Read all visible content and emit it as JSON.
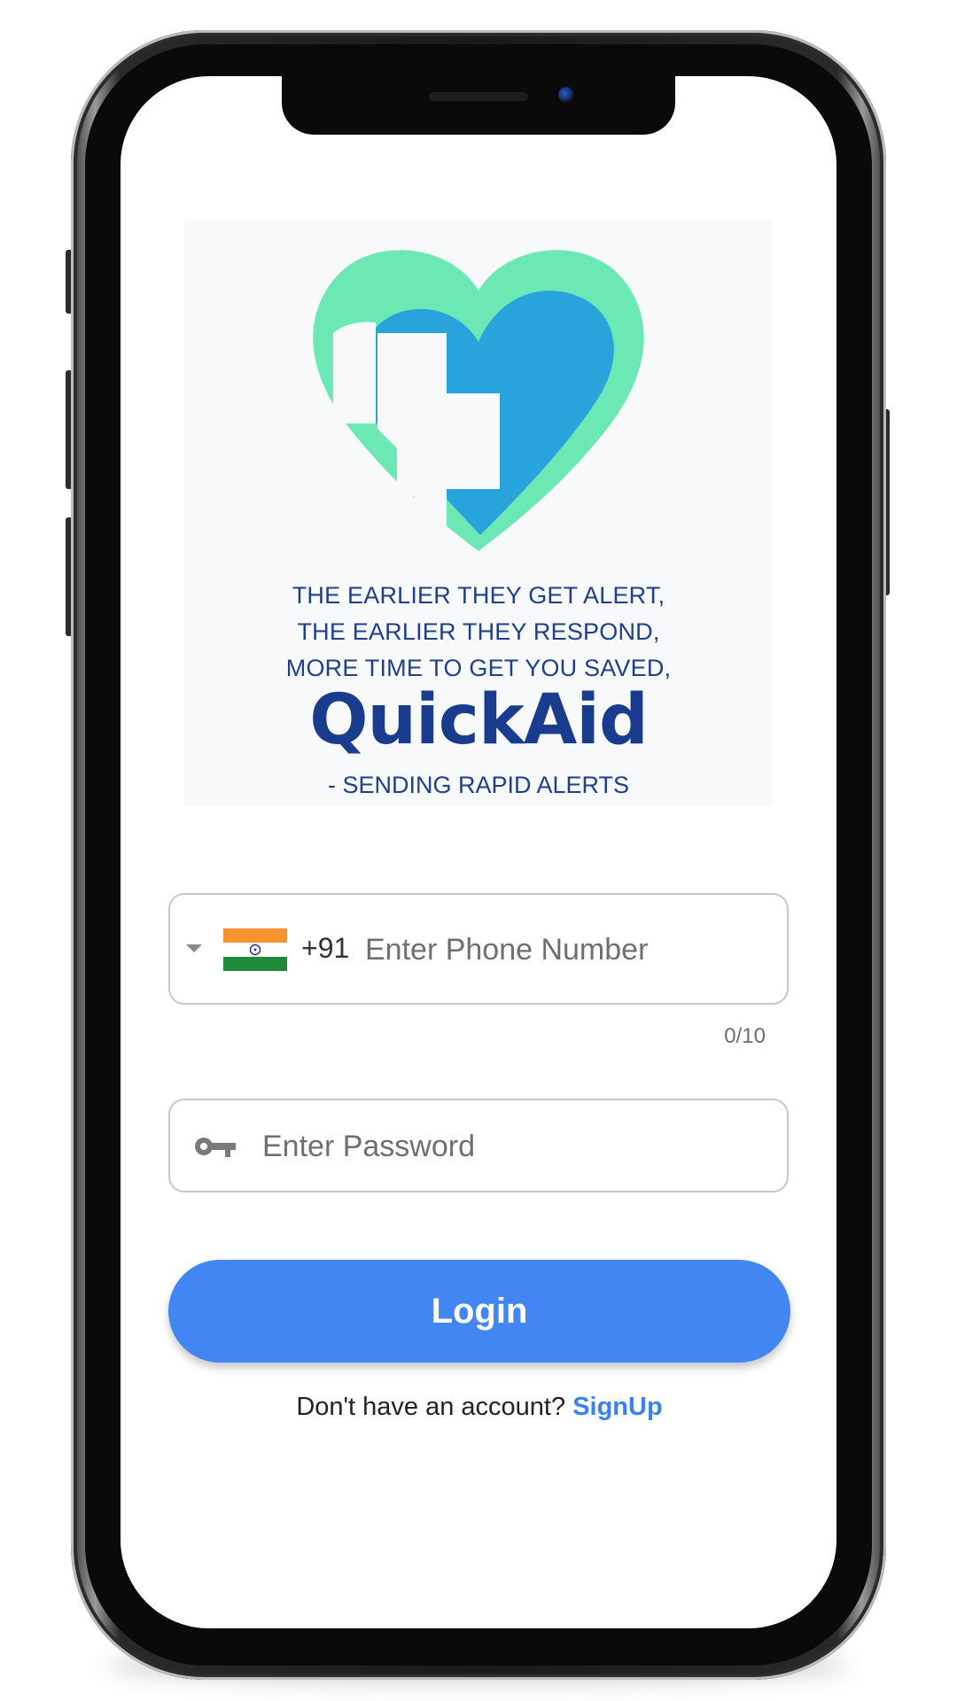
{
  "app": {
    "name": "QuickAid"
  },
  "banner": {
    "tagline_lines": [
      "THE EARLIER THEY GET ALERT,",
      "THE EARLIER THEY RESPOND,",
      "MORE TIME TO GET YOU SAVED,"
    ],
    "brand": "QuickAid",
    "slogan": "- SENDING RAPID ALERTS",
    "colors": {
      "heart_outer": "#6be8b3",
      "heart_inner": "#29a3dc",
      "text": "#1e3f8e"
    }
  },
  "phone_field": {
    "country_flag": "india-flag-icon",
    "dial_code": "+91",
    "placeholder": "Enter Phone Number",
    "value": "",
    "counter": "0/10"
  },
  "password_field": {
    "icon": "key-icon",
    "placeholder": "Enter Password",
    "value": ""
  },
  "login_button": {
    "label": "Login",
    "color": "#4286f4"
  },
  "signup": {
    "prompt": "Don't have an account?",
    "link_label": "SignUp",
    "link_color": "#3b82f0"
  }
}
